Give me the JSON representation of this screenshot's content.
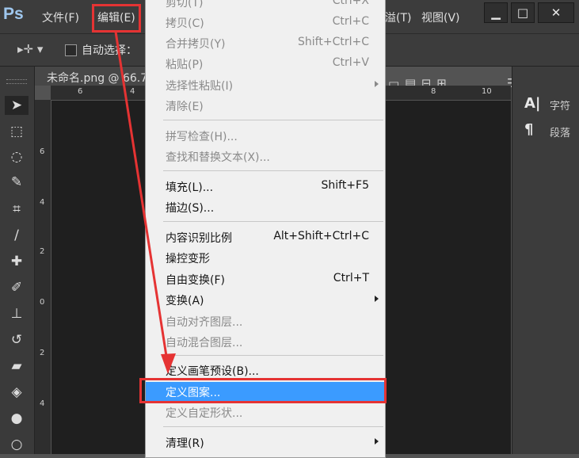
{
  "app": {
    "logo": "Ps"
  },
  "menubar": {
    "items": [
      {
        "label": "文件(F)"
      },
      {
        "label": "编辑(E)"
      },
      {
        "label": "溢(T)"
      },
      {
        "label": "视图(V)"
      }
    ],
    "window_buttons": [
      "▁",
      "□",
      "✕"
    ]
  },
  "options_bar": {
    "auto_select_label": "自动选择："
  },
  "document": {
    "tab_title": "未命名.png @ 66.7"
  },
  "ruler": {
    "top": [
      "6",
      "4",
      "8",
      "10"
    ],
    "left": [
      "6",
      "4",
      "2",
      "0",
      "2",
      "4"
    ]
  },
  "right_panel": {
    "items": [
      {
        "label": "字符",
        "icon": "A|"
      },
      {
        "label": "段落",
        "icon": "¶"
      }
    ]
  },
  "edit_menu": {
    "items": [
      {
        "label": "剪切(T)",
        "shortcut": "Ctrl+X",
        "disabled": true
      },
      {
        "label": "拷贝(C)",
        "shortcut": "Ctrl+C",
        "disabled": true
      },
      {
        "label": "合并拷贝(Y)",
        "shortcut": "Shift+Ctrl+C",
        "disabled": true
      },
      {
        "label": "粘贴(P)",
        "shortcut": "Ctrl+V",
        "disabled": true
      },
      {
        "label": "选择性粘贴(I)",
        "shortcut": "",
        "disabled": true,
        "submenu": true
      },
      {
        "label": "清除(E)",
        "shortcut": "",
        "disabled": true
      },
      {
        "label": "拼写检查(H)...",
        "shortcut": "",
        "disabled": true
      },
      {
        "label": "查找和替换文本(X)...",
        "shortcut": "",
        "disabled": true
      },
      {
        "label": "填充(L)...",
        "shortcut": "Shift+F5",
        "disabled": false
      },
      {
        "label": "描边(S)...",
        "shortcut": "",
        "disabled": false
      },
      {
        "label": "内容识别比例",
        "shortcut": "Alt+Shift+Ctrl+C",
        "disabled": false
      },
      {
        "label": "操控变形",
        "shortcut": "",
        "disabled": false
      },
      {
        "label": "自由变换(F)",
        "shortcut": "Ctrl+T",
        "disabled": false
      },
      {
        "label": "变换(A)",
        "shortcut": "",
        "disabled": false,
        "submenu": true
      },
      {
        "label": "自动对齐图层...",
        "shortcut": "",
        "disabled": true
      },
      {
        "label": "自动混合图层...",
        "shortcut": "",
        "disabled": true
      },
      {
        "label": "定义画笔预设(B)...",
        "shortcut": "",
        "disabled": false
      },
      {
        "label": "定义图案...",
        "shortcut": "",
        "disabled": false,
        "highlighted": true
      },
      {
        "label": "定义自定形状...",
        "shortcut": "",
        "disabled": true
      },
      {
        "label": "清理(R)",
        "shortcut": "",
        "disabled": false,
        "submenu": true
      }
    ]
  },
  "colors": {
    "annotation_red": "#e53333",
    "menu_highlight": "#3b9bff"
  }
}
